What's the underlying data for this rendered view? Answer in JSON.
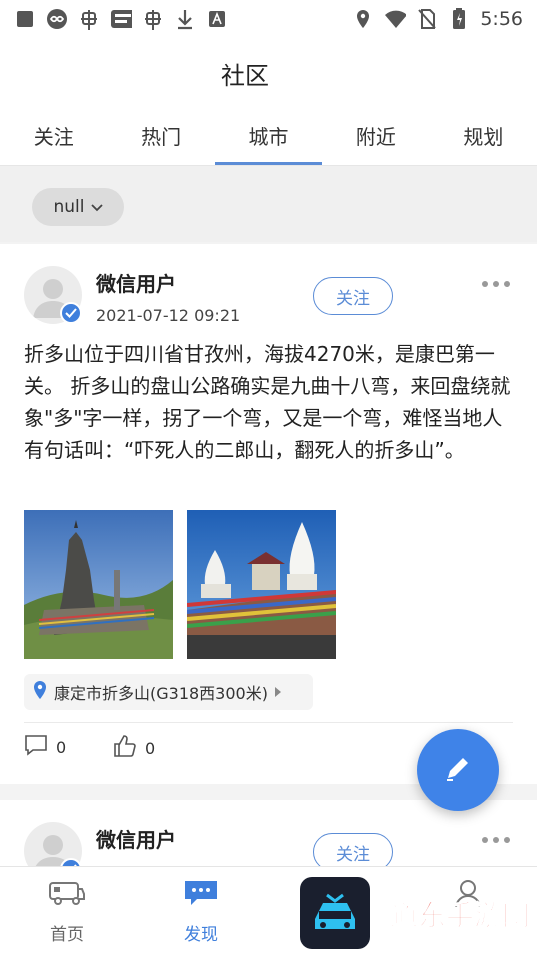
{
  "status_bar": {
    "time": "5:56",
    "left_icons": [
      "square-icon",
      "infinity-icon",
      "bug-icon",
      "app-badge-icon",
      "bug-icon",
      "download-icon",
      "a-icon"
    ],
    "right_icons": [
      "location-icon",
      "wifi-icon",
      "no-sim-icon",
      "battery-icon"
    ]
  },
  "header": {
    "title": "社区"
  },
  "tabs": [
    {
      "label": "关注"
    },
    {
      "label": "热门"
    },
    {
      "label": "城市"
    },
    {
      "label": "附近"
    },
    {
      "label": "规划"
    }
  ],
  "active_tab": 2,
  "filter": {
    "chip_label": "null"
  },
  "posts": [
    {
      "username": "微信用户",
      "date": "2021-07-12 09:21",
      "follow_label": "关注",
      "content": "折多山位于四川省甘孜州，海拔4270米，是康巴第一关。 折多山的盘山公路确实是九曲十八弯，来回盘绕就象\"多\"字一样，拐了一个弯，又是一个弯，难怪当地人有句话叫：“吓死人的二郎山，翻死人的折多山”。",
      "location": "康定市折多山(G318西300米)",
      "comments": "0",
      "likes": "0"
    },
    {
      "username": "微信用户",
      "follow_label": "关注"
    }
  ],
  "bottom_nav": [
    {
      "label": "首页"
    },
    {
      "label": "发现"
    }
  ],
  "watermark": {
    "text": "道东手游网"
  },
  "colors": {
    "accent": "#3f7fdc",
    "fab": "#3f83e8",
    "tab_indicator": "#5b8cd6"
  }
}
